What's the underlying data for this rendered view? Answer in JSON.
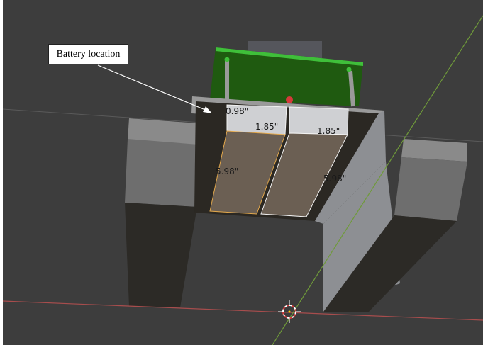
{
  "callout": {
    "text": "Battery location"
  },
  "dimensions": {
    "battery_thickness": "0.98\"",
    "left_battery_width": "1.85\"",
    "right_battery_width": "1.85\"",
    "left_battery_length": "5.98\"",
    "right_battery_length": "5.98\""
  },
  "colors": {
    "background": "#3d3d3d",
    "pcb_green": "#1f5a10",
    "pcb_edge": "#3fbf3a",
    "battery_face": "#6b5f53",
    "battery_top": "#cfd0d3",
    "x_axis": "#a84d4d",
    "y_axis": "#6f9a3a"
  },
  "icons": [
    "3d-cursor-icon"
  ]
}
